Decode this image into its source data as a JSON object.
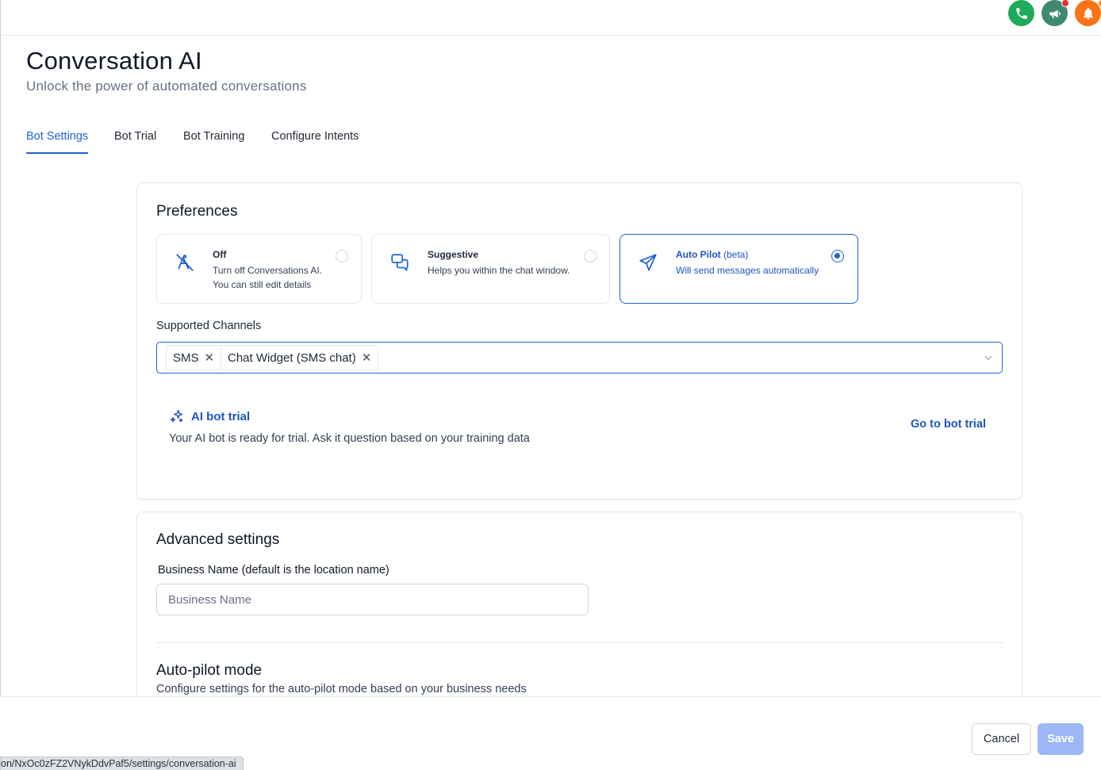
{
  "header": {
    "title": "Conversation AI",
    "subtitle": "Unlock the power of automated conversations"
  },
  "top_icons": [
    "phone-icon",
    "megaphone-icon",
    "bell-icon"
  ],
  "tabs": [
    {
      "label": "Bot Settings",
      "active": true
    },
    {
      "label": "Bot Trial",
      "active": false
    },
    {
      "label": "Bot Training",
      "active": false
    },
    {
      "label": "Configure Intents",
      "active": false
    }
  ],
  "preferences": {
    "title": "Preferences",
    "options": [
      {
        "title": "Off",
        "title_suffix": "",
        "desc_line1": "Turn off Conversations AI.",
        "desc_line2": "You can still edit details",
        "selected": false,
        "icon": "bot-off-icon"
      },
      {
        "title": "Suggestive",
        "title_suffix": "",
        "desc_line1": "Helps you within the chat window.",
        "desc_line2": "",
        "selected": false,
        "icon": "chat-bubbles-icon"
      },
      {
        "title": "Auto Pilot",
        "title_suffix": "(beta)",
        "desc_line1": "Will send messages automatically",
        "desc_line2": "",
        "selected": true,
        "icon": "paper-plane-icon"
      }
    ],
    "channels_label": "Supported Channels",
    "channels": [
      "SMS",
      "Chat Widget (SMS chat)"
    ],
    "trial": {
      "title": "AI bot trial",
      "description": "Your AI bot is ready for trial. Ask it question based on your training data",
      "link": "Go to bot trial"
    }
  },
  "advanced": {
    "title": "Advanced settings",
    "business_name_label": "Business Name (default is the location name)",
    "business_name_value": "",
    "business_name_placeholder": "Business Name",
    "autopilot_title": "Auto-pilot mode",
    "autopilot_desc": "Configure settings for the auto-pilot mode based on your business needs"
  },
  "footer": {
    "cancel_label": "Cancel",
    "save_label": "Save"
  },
  "status_url": "on/NxOc0zFZ2VNykDdvPaf5/settings/conversation-ai",
  "colors": {
    "accent": "#1e63d6",
    "phone": "#1faa59",
    "megaphone": "#3f8a6e",
    "bell": "#f97316",
    "save_disabled": "#9db8f6"
  }
}
